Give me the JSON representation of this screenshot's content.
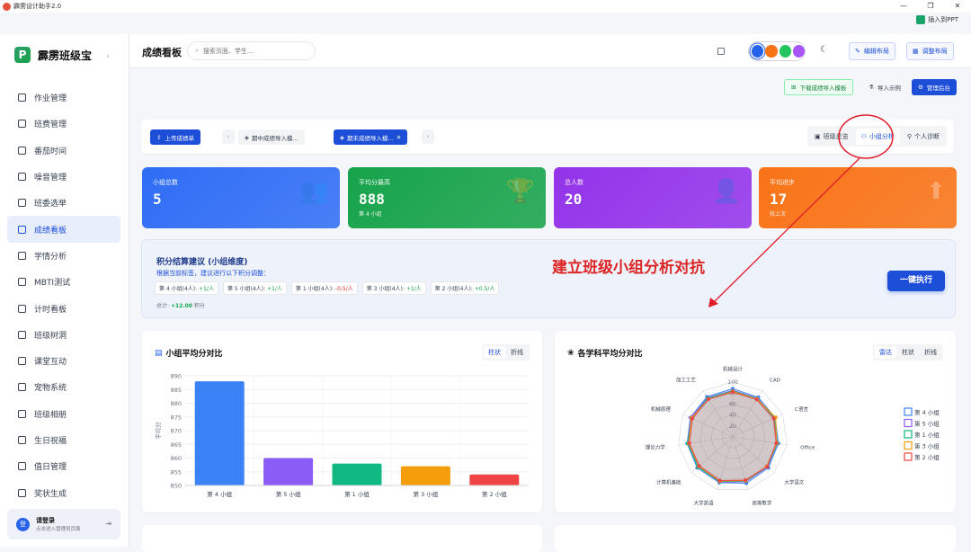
{
  "window": {
    "title": "霹雳设计助手2.0",
    "ppt_button": "插入到PPT",
    "controls": [
      "—",
      "❐",
      "✕"
    ]
  },
  "sidebar": {
    "brand": "霹雳班级宝",
    "collapse_icon": "‹",
    "items": [
      {
        "label": "作业管理",
        "icon": "book-icon"
      },
      {
        "label": "班费管理",
        "icon": "wallet-icon"
      },
      {
        "label": "番茄时间",
        "icon": "timer-icon"
      },
      {
        "label": "噪音管理",
        "icon": "sound-icon"
      },
      {
        "label": "班委选举",
        "icon": "vote-icon"
      },
      {
        "label": "成绩看板",
        "icon": "chart-icon",
        "active": true
      },
      {
        "label": "学情分析",
        "icon": "trend-icon"
      },
      {
        "label": "MBTI测试",
        "icon": "compass-icon"
      },
      {
        "label": "计时看板",
        "icon": "clock-icon"
      },
      {
        "label": "班级树洞",
        "icon": "chat-icon"
      },
      {
        "label": "课堂互动",
        "icon": "hand-icon"
      },
      {
        "label": "宠物系统",
        "icon": "paw-icon"
      },
      {
        "label": "班级相册",
        "icon": "image-icon"
      },
      {
        "label": "生日祝福",
        "icon": "cake-icon"
      },
      {
        "label": "值日管理",
        "icon": "calendar-icon"
      },
      {
        "label": "奖状生成",
        "icon": "award-icon"
      }
    ],
    "user": {
      "avatar": "登",
      "login": "请登录",
      "hint": "点击进入管理员页面"
    }
  },
  "topbar": {
    "title": "成绩看板",
    "search_placeholder": "搜索页面、学生...",
    "theme_colors": [
      "#2563eb",
      "#f97316",
      "#22c55e",
      "#a855f7"
    ],
    "edit_layout": "编辑布局",
    "adjust_layout": "调整布局"
  },
  "actions": {
    "download_template": "下载成绩导入模板",
    "import_example": "导入示例",
    "admin": "管理后台"
  },
  "filter": {
    "upload": "上传成绩单",
    "tabs": [
      {
        "label": "期中成绩导入模...",
        "active": false
      },
      {
        "label": "期末成绩导入模...",
        "active": true
      }
    ],
    "views": [
      {
        "label": "班级总览",
        "active": false
      },
      {
        "label": "小组分析",
        "active": true
      },
      {
        "label": "个人诊断",
        "active": false
      }
    ]
  },
  "stats": [
    {
      "label": "小组总数",
      "value": "5",
      "sub": "",
      "color": "#2f6df6",
      "icon": "group-icon",
      "glyph": "👥"
    },
    {
      "label": "平均分最高",
      "value": "888",
      "sub": "第 4 小组",
      "color": "#16a34a",
      "icon": "trophy-icon",
      "glyph": "🏆"
    },
    {
      "label": "总人数",
      "value": "20",
      "sub": "",
      "color": "#9333ea",
      "icon": "person-icon",
      "glyph": "👤"
    },
    {
      "label": "平均进步",
      "value": "17",
      "sub": "较上次",
      "color": "#f97316",
      "icon": "arrow-up-circle-icon",
      "glyph": "⬆"
    }
  ],
  "suggestion": {
    "title": "积分结算建议 (小组维度)",
    "desc": "根据当前标签，建议进行以下积分调整：",
    "chips": [
      {
        "group": "第 4 小组(4人):",
        "delta": "+1/人",
        "sign": "pos"
      },
      {
        "group": "第 5 小组(4人):",
        "delta": "+1/人",
        "sign": "pos"
      },
      {
        "group": "第 1 小组(4人):",
        "delta": "-0.5/人",
        "sign": "neg"
      },
      {
        "group": "第 3 小组(4人):",
        "delta": "+1/人",
        "sign": "pos"
      },
      {
        "group": "第 2 小组(4人):",
        "delta": "+0.5/人",
        "sign": "pos"
      }
    ],
    "total_label": "总计:",
    "total_value": "+12.00",
    "total_unit": "积分",
    "execute": "一键执行"
  },
  "bar_panel": {
    "title": "小组平均分对比",
    "toggles": [
      {
        "label": "柱状",
        "active": true
      },
      {
        "label": "折线",
        "active": false
      }
    ]
  },
  "radar_panel": {
    "title": "各学科平均分对比",
    "toggles": [
      {
        "label": "雷达",
        "active": true
      },
      {
        "label": "柱状",
        "active": false
      },
      {
        "label": "折线",
        "active": false
      }
    ]
  },
  "annotation": "建立班级小组分析对抗",
  "chart_data": [
    {
      "type": "bar",
      "categories": [
        "第 4 小组",
        "第 5 小组",
        "第 1 小组",
        "第 3 小组",
        "第 2 小组"
      ],
      "values": [
        888,
        860,
        858,
        857,
        854
      ],
      "colors": [
        "#3b82f6",
        "#8b5cf6",
        "#10b981",
        "#f59e0b",
        "#ef4444"
      ],
      "ylabel": "平均分",
      "ylim": [
        850,
        890
      ],
      "yticks": [
        850,
        855,
        860,
        865,
        870,
        875,
        880,
        885,
        890
      ],
      "grid": true
    },
    {
      "type": "radar",
      "axes": [
        "机械设计",
        "CAD",
        "C语言",
        "Office",
        "大学语文",
        "高等数学",
        "大学英语",
        "计算机基础",
        "理论力学",
        "机械原理",
        "加工工艺"
      ],
      "rticks": [
        20,
        40,
        60,
        80,
        100
      ],
      "rlim": [
        0,
        100
      ],
      "series": [
        {
          "name": "第 4 小组",
          "color": "#3b82f6",
          "values": [
            88,
            86,
            85,
            84,
            86,
            88,
            87,
            86,
            84,
            85,
            87
          ]
        },
        {
          "name": "第 5 小组",
          "color": "#8b5cf6",
          "values": [
            85,
            84,
            83,
            82,
            84,
            85,
            86,
            83,
            82,
            84,
            85
          ]
        },
        {
          "name": "第 1 小组",
          "color": "#10b981",
          "values": [
            84,
            83,
            84,
            82,
            83,
            84,
            85,
            84,
            83,
            82,
            84
          ]
        },
        {
          "name": "第 3 小组",
          "color": "#f59e0b",
          "values": [
            83,
            82,
            86,
            81,
            82,
            83,
            84,
            82,
            81,
            83,
            82
          ]
        },
        {
          "name": "第 2 小组",
          "color": "#ef4444",
          "values": [
            82,
            81,
            82,
            80,
            83,
            82,
            83,
            81,
            80,
            81,
            82
          ]
        }
      ],
      "legend": "right"
    }
  ]
}
